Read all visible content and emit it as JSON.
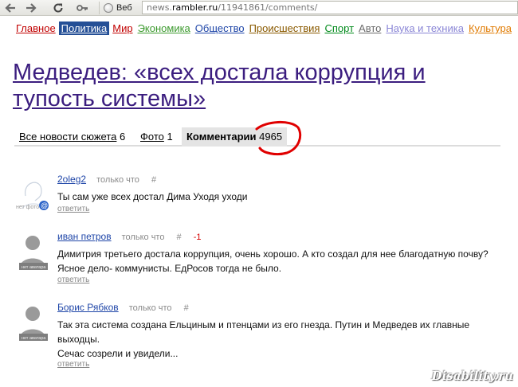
{
  "browser": {
    "tab_label": "Веб",
    "url_prefix": "news.",
    "url_host": "rambler.ru",
    "url_path": "/11941861/comments/"
  },
  "nav": {
    "items": [
      {
        "label": "Главное",
        "color": "#c10000"
      },
      {
        "label": "Политика",
        "color": "#ffffff",
        "active": true
      },
      {
        "label": "Мир",
        "color": "#c10000"
      },
      {
        "label": "Экономика",
        "color": "#3c9a2e"
      },
      {
        "label": "Общество",
        "color": "#1f46a8"
      },
      {
        "label": "Происшествия",
        "color": "#8a5a00"
      },
      {
        "label": "Спорт",
        "color": "#008a1a"
      },
      {
        "label": "Авто",
        "color": "#6b6b6b"
      },
      {
        "label": "Наука и техника",
        "color": "#8a86d6"
      },
      {
        "label": "Культура",
        "color": "#e07a00"
      }
    ]
  },
  "headline": "Медведев: «всех достала коррупция и тупость системы»",
  "tabs": {
    "all_news_label": "Все новости сюжета",
    "all_news_count": "6",
    "photo_label": "Фото",
    "photo_count": "1",
    "comments_label": "Комментарии",
    "comments_count": "4965"
  },
  "comments": [
    {
      "author": "2oleg2",
      "time": "только что",
      "hash": "#",
      "score": "",
      "text": "Ты сам уже всех достал Дима Уходя уходи",
      "reply": "ответить",
      "avatar_label": "нет фото"
    },
    {
      "author": "иван петров",
      "time": "только что",
      "hash": "#",
      "score": "-1",
      "text": "Димитрия третьего достала коррупция, очень хорошо. А кто создал для нее благодатную почву?\nЯсное дело- коммунисты. ЕдРосов тогда не было.",
      "reply": "ответить",
      "avatar_label": "нет аватара"
    },
    {
      "author": "Борис Рябков",
      "time": "только что",
      "hash": "#",
      "score": "",
      "text": "Так эта система создана Ельциным и птенцами из его гнезда. Путин и Медведев их главные\nвыходцы.\nСечас созрели и увидели...",
      "reply": "ответить",
      "avatar_label": "нет аватара"
    }
  ],
  "watermark": "Disability.ru",
  "colors": {
    "headline": "#3b1d7f",
    "active_nav_bg": "#244f96",
    "circle_annotation": "#e00000"
  }
}
